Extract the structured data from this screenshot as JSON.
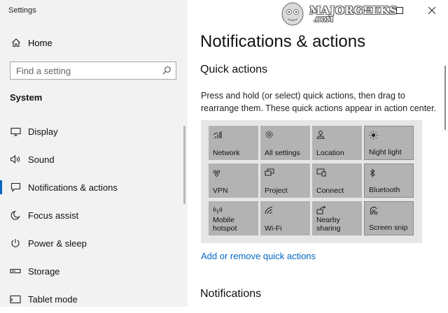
{
  "window": {
    "title": "Settings"
  },
  "watermark": {
    "text": "MAJORGEEKS",
    "sub": ".COM"
  },
  "sidebar": {
    "home_label": "Home",
    "search_placeholder": "Find a setting",
    "section_label": "System",
    "items": [
      {
        "label": "Display",
        "icon": "display-icon",
        "active": false
      },
      {
        "label": "Sound",
        "icon": "speaker-icon",
        "active": false
      },
      {
        "label": "Notifications & actions",
        "icon": "notification-icon",
        "active": true
      },
      {
        "label": "Focus assist",
        "icon": "moon-icon",
        "active": false
      },
      {
        "label": "Power & sleep",
        "icon": "power-icon",
        "active": false
      },
      {
        "label": "Storage",
        "icon": "storage-icon",
        "active": false
      },
      {
        "label": "Tablet mode",
        "icon": "tablet-icon",
        "active": false
      }
    ]
  },
  "main": {
    "title": "Notifications & actions",
    "quick_actions_heading": "Quick actions",
    "description": "Press and hold (or select) quick actions, then drag to rearrange them. These quick actions appear in action center.",
    "tiles": [
      {
        "label": "Network",
        "icon": "network-icon"
      },
      {
        "label": "All settings",
        "icon": "gear-icon"
      },
      {
        "label": "Location",
        "icon": "location-icon"
      },
      {
        "label": "Night light",
        "icon": "sun-icon"
      },
      {
        "label": "VPN",
        "icon": "vpn-icon"
      },
      {
        "label": "Project",
        "icon": "project-icon"
      },
      {
        "label": "Connect",
        "icon": "connect-icon"
      },
      {
        "label": "Bluetooth",
        "icon": "bluetooth-icon"
      },
      {
        "label": "Mobile\nhotspot",
        "icon": "hotspot-icon"
      },
      {
        "label": "Wi-Fi",
        "icon": "wifi-icon"
      },
      {
        "label": "Nearby\nsharing",
        "icon": "nearby-sharing-icon"
      },
      {
        "label": "Screen snip",
        "icon": "screen-snip-icon"
      }
    ],
    "add_remove_link": "Add or remove quick actions",
    "notifications_heading": "Notifications"
  },
  "colors": {
    "accent": "#0067c0",
    "sidebar_bg": "#f2f2f2",
    "tile_bg": "#b3b3b3",
    "grid_bg": "#e6e6e6"
  }
}
